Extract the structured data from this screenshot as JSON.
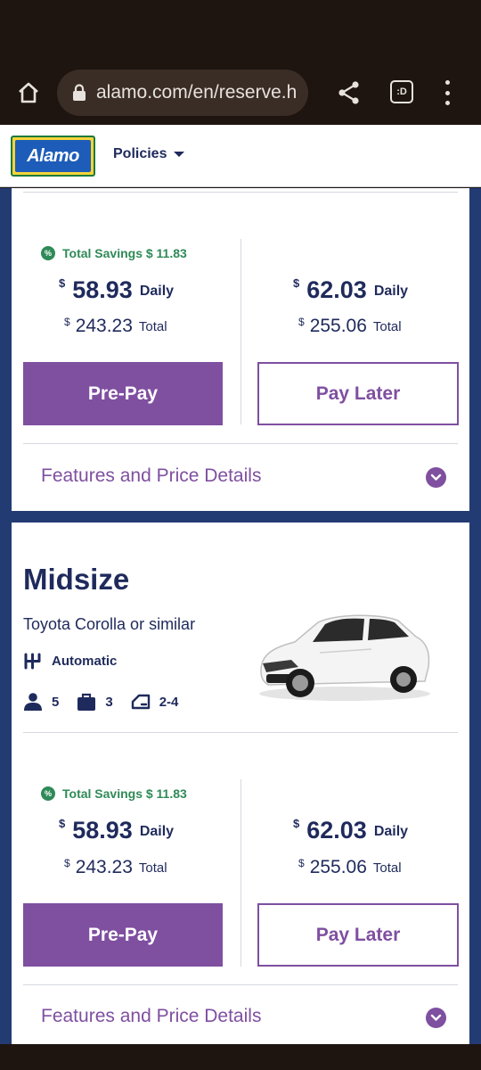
{
  "browser": {
    "url": "alamo.com/en/reserve.h",
    "tab_label": ":D"
  },
  "header": {
    "logo_text": "Alamo",
    "policies_label": "Policies"
  },
  "cards": [
    {
      "savings": "Total Savings $ 11.83",
      "prepay": {
        "currency": "$",
        "daily": "58.93",
        "daily_label": "Daily",
        "total_currency": "$",
        "total": "243.23",
        "total_label": "Total",
        "button": "Pre-Pay"
      },
      "paylater": {
        "currency": "$",
        "daily": "62.03",
        "daily_label": "Daily",
        "total_currency": "$",
        "total": "255.06",
        "total_label": "Total",
        "button": "Pay Later"
      },
      "features_label": "Features and Price Details"
    },
    {
      "class_name": "Midsize",
      "model": "Toyota Corolla or similar",
      "transmission": "Automatic",
      "passengers": "5",
      "bags": "3",
      "doors": "2-4",
      "savings": "Total Savings $ 11.83",
      "prepay": {
        "currency": "$",
        "daily": "58.93",
        "daily_label": "Daily",
        "total_currency": "$",
        "total": "243.23",
        "total_label": "Total",
        "button": "Pre-Pay"
      },
      "paylater": {
        "currency": "$",
        "daily": "62.03",
        "daily_label": "Daily",
        "total_currency": "$",
        "total": "255.06",
        "total_label": "Total",
        "button": "Pay Later"
      },
      "features_label": "Features and Price Details"
    }
  ],
  "colors": {
    "navy": "#1f2a5c",
    "purple": "#7f4fa0",
    "green": "#2e8a57",
    "page_bg": "#233b73"
  }
}
